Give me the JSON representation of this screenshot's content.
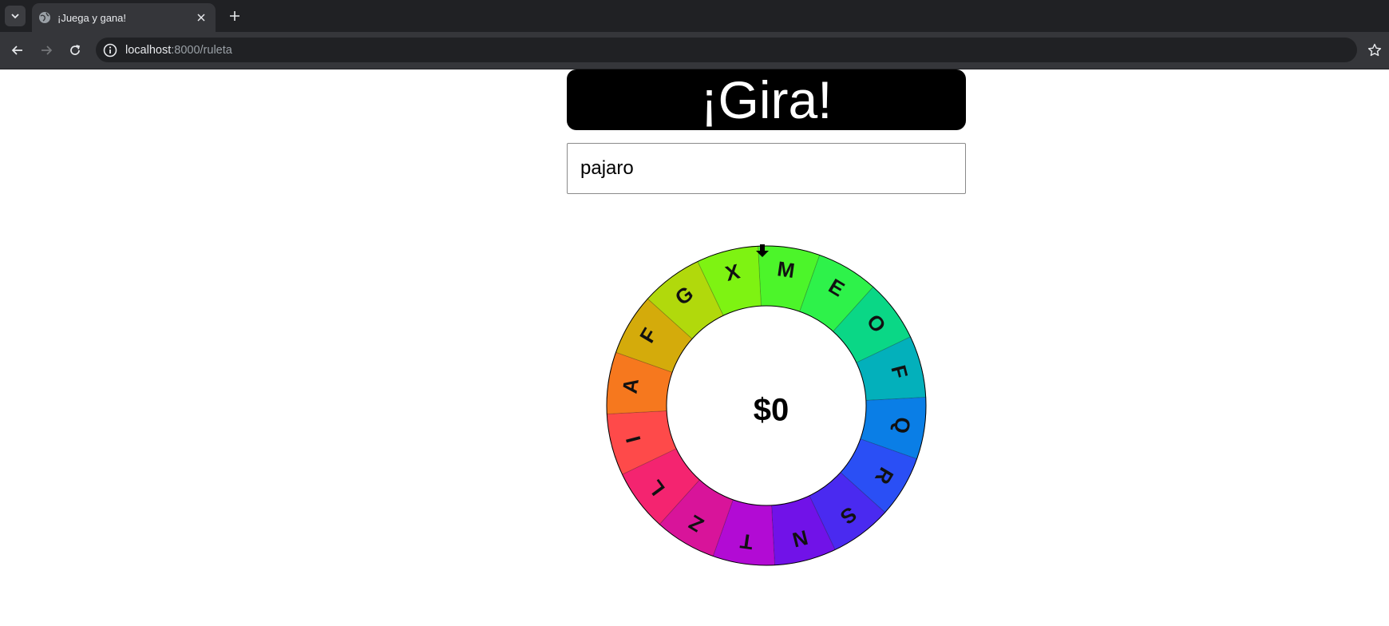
{
  "browser": {
    "tab_title": "¡Juega y gana!",
    "url_host": "localhost",
    "url_path": ":8000/ruleta"
  },
  "page": {
    "spin_button_label": "¡Gira!",
    "word_input_value": "pajaro",
    "wheel": {
      "amount": "$0",
      "segments": [
        {
          "letter": "M",
          "color": "#4cf52a"
        },
        {
          "letter": "E",
          "color": "#2ef24a"
        },
        {
          "letter": "O",
          "color": "#0ad786"
        },
        {
          "letter": "F",
          "color": "#03b0bb"
        },
        {
          "letter": "Q",
          "color": "#0a7ee6"
        },
        {
          "letter": "R",
          "color": "#2a4ff5"
        },
        {
          "letter": "S",
          "color": "#4a2af0"
        },
        {
          "letter": "N",
          "color": "#7112e8"
        },
        {
          "letter": "T",
          "color": "#b20bd4"
        },
        {
          "letter": "Z",
          "color": "#d8149a"
        },
        {
          "letter": "L",
          "color": "#f42470"
        },
        {
          "letter": "I",
          "color": "#fe4a4a"
        },
        {
          "letter": "A",
          "color": "#f6781e"
        },
        {
          "letter": "F",
          "color": "#d4ab0b"
        },
        {
          "letter": "G",
          "color": "#b1d90c"
        },
        {
          "letter": "X",
          "color": "#7ef312"
        }
      ]
    }
  }
}
